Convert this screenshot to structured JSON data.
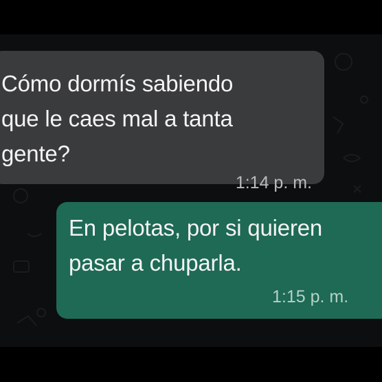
{
  "conversation": {
    "messages": [
      {
        "direction": "incoming",
        "text": "Cómo dormís sabiendo\nque le caes mal a tanta\ngente?",
        "time": "1:14 p. m."
      },
      {
        "direction": "outgoing",
        "text": "En pelotas, por si quieren\npasar a chuparla.",
        "time": "1:15 p. m."
      }
    ]
  },
  "colors": {
    "background": "#000000",
    "chat_background": "#0c0e0f",
    "incoming_bubble": "#3a3b3d",
    "outgoing_bubble": "#1e6a54",
    "message_text": "#f4f4f4",
    "timestamp_text": "#b9bcbd"
  },
  "icons": {
    "wallpaper": "doodle-pattern-icon"
  }
}
